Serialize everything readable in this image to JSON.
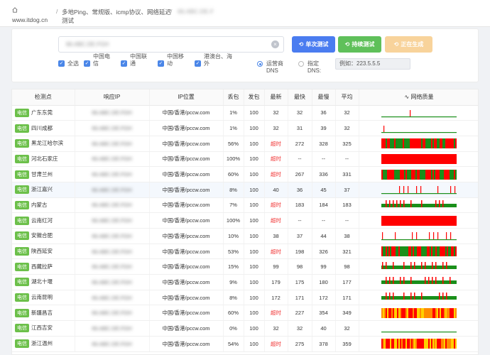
{
  "header": {
    "site": "www.itdog.cn",
    "breadcrumb_sep": "/",
    "crumb1": "多地Ping、常规版、icmp协议、网络延迟测试",
    "crumb2": "66.ABC.DE.F"
  },
  "controls": {
    "target_value": "66.ABC.DE.FGH",
    "btn_once": "单次测试",
    "btn_continuous": "持续测试",
    "btn_generate": "正在生成",
    "checkboxes": [
      "全选",
      "中国电信",
      "中国联通",
      "中国移动",
      "港澳台、海外"
    ],
    "radio_isp_dns": "运营商DNS",
    "radio_custom_dns": "指定DNS:",
    "dns_value": "例如：223.5.5.5"
  },
  "table": {
    "headers": [
      "检测点",
      "响应IP",
      "IP位置",
      "丢包",
      "发包",
      "最新",
      "最快",
      "最慢",
      "平均",
      "网络质量"
    ],
    "rows": [
      {
        "isp": "电信",
        "node": "广东东莞",
        "ip": "66.ABC.DE.FGH",
        "loc": "中国/香港/pccw.com",
        "loss": "1%",
        "sent": "100",
        "latest": "32",
        "fastest": "32",
        "slowest": "36",
        "avg": "32"
      },
      {
        "isp": "电信",
        "node": "四川成都",
        "ip": "66.ABC.DE.FGH",
        "loc": "中国/香港/pccw.com",
        "loss": "1%",
        "sent": "100",
        "latest": "32",
        "fastest": "31",
        "slowest": "39",
        "avg": "32"
      },
      {
        "isp": "电信",
        "node": "黑龙江哈尔滨",
        "ip": "66.ABC.DE.FGH",
        "loc": "中国/香港/pccw.com",
        "loss": "56%",
        "sent": "100",
        "latest": "超时",
        "fastest": "272",
        "slowest": "328",
        "avg": "325"
      },
      {
        "isp": "电信",
        "node": "河北石家庄",
        "ip": "66.ABC.DE.FGH",
        "loc": "中国/香港/pccw.com",
        "loss": "100%",
        "sent": "100",
        "latest": "超时",
        "fastest": "--",
        "slowest": "--",
        "avg": "--"
      },
      {
        "isp": "电信",
        "node": "甘肃兰州",
        "ip": "66.ABC.DE.FGH",
        "loc": "中国/香港/pccw.com",
        "loss": "60%",
        "sent": "100",
        "latest": "超时",
        "fastest": "267",
        "slowest": "336",
        "avg": "331"
      },
      {
        "isp": "电信",
        "node": "浙江嘉兴",
        "ip": "66.ABC.DE.FGH",
        "loc": "中国/香港/pccw.com",
        "loss": "8%",
        "sent": "100",
        "latest": "40",
        "fastest": "36",
        "slowest": "45",
        "avg": "37"
      },
      {
        "isp": "电信",
        "node": "内蒙古",
        "ip": "66.ABC.DE.FGH",
        "loc": "中国/香港/pccw.com",
        "loss": "7%",
        "sent": "100",
        "latest": "超时",
        "fastest": "183",
        "slowest": "184",
        "avg": "183"
      },
      {
        "isp": "电信",
        "node": "云南红河",
        "ip": "66.ABC.DE.FGH",
        "loc": "中国/香港/pccw.com",
        "loss": "100%",
        "sent": "100",
        "latest": "超时",
        "fastest": "--",
        "slowest": "--",
        "avg": "--"
      },
      {
        "isp": "电信",
        "node": "安徽合肥",
        "ip": "66.ABC.DE.FGH",
        "loc": "中国/香港/pccw.com",
        "loss": "10%",
        "sent": "100",
        "latest": "38",
        "fastest": "37",
        "slowest": "44",
        "avg": "38"
      },
      {
        "isp": "电信",
        "node": "陕西延安",
        "ip": "66.ABC.DE.FGH",
        "loc": "中国/香港/pccw.com",
        "loss": "53%",
        "sent": "100",
        "latest": "超时",
        "fastest": "198",
        "slowest": "326",
        "avg": "321"
      },
      {
        "isp": "电信",
        "node": "西藏拉萨",
        "ip": "66.ABC.DE.FGH",
        "loc": "中国/香港/pccw.com",
        "loss": "15%",
        "sent": "100",
        "latest": "99",
        "fastest": "98",
        "slowest": "99",
        "avg": "98"
      },
      {
        "isp": "电信",
        "node": "湖北十堰",
        "ip": "66.ABC.DE.FGH",
        "loc": "中国/香港/pccw.com",
        "loss": "9%",
        "sent": "100",
        "latest": "179",
        "fastest": "175",
        "slowest": "180",
        "avg": "177"
      },
      {
        "isp": "电信",
        "node": "云南昆明",
        "ip": "66.ABC.DE.FGH",
        "loc": "中国/香港/pccw.com",
        "loss": "8%",
        "sent": "100",
        "latest": "172",
        "fastest": "171",
        "slowest": "172",
        "avg": "171"
      },
      {
        "isp": "电信",
        "node": "新疆昌吉",
        "ip": "66.ABC.DE.FGH",
        "loc": "中国/香港/pccw.com",
        "loss": "60%",
        "sent": "100",
        "latest": "超时",
        "fastest": "227",
        "slowest": "354",
        "avg": "349"
      },
      {
        "isp": "电信",
        "node": "江西吉安",
        "ip": "66.ABC.DE.FGH",
        "loc": "中国/香港/pccw.com",
        "loss": "0%",
        "sent": "100",
        "latest": "32",
        "fastest": "32",
        "slowest": "40",
        "avg": "32"
      },
      {
        "isp": "电信",
        "node": "浙江温州",
        "ip": "66.ABC.DE.FGH",
        "loc": "中国/香港/pccw.com",
        "loss": "54%",
        "sent": "100",
        "latest": "超时",
        "fastest": "275",
        "slowest": "378",
        "avg": "359"
      }
    ],
    "quality_patterns": [
      "line-few-red",
      "line-few-red",
      "mixed-dense",
      "solid-red",
      "mixed-dense",
      "line-red-spikes",
      "green-band-red",
      "solid-red",
      "line-red-spikes",
      "mixed-dense",
      "green-band-red",
      "green-band-red",
      "green-band-red",
      "orange-yellow",
      "line-flat",
      "orange-yellow"
    ]
  },
  "colors": {
    "green": "#1a8f1a",
    "red": "#ff0000",
    "orange": "#ff8c00",
    "yellow": "#ffd000",
    "blue_btn": "#4a7cf0",
    "green_btn": "#5fc05a",
    "orange_btn": "#f8d39b"
  }
}
